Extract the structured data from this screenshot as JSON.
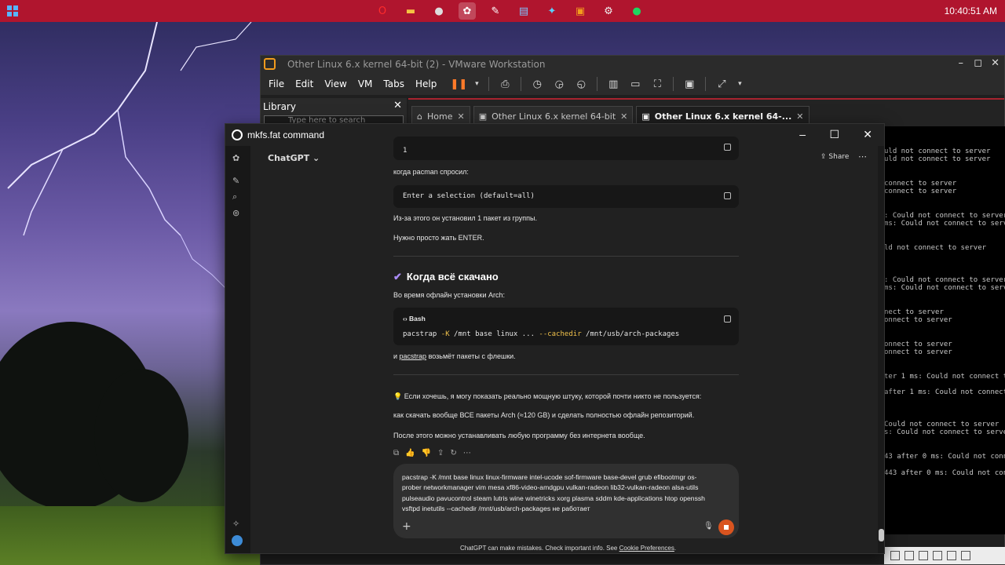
{
  "taskbar": {
    "clock": "10:40:51 AM",
    "icons": [
      "opera-icon",
      "file-explorer-icon",
      "obs-icon",
      "chatgpt-icon",
      "tool-icon",
      "notes-icon",
      "paint-icon",
      "vmware-icon",
      "settings-icon",
      "spotify-icon"
    ]
  },
  "vmware": {
    "title": "Other Linux 6.x kernel 64-bit (2) - VMware Workstation",
    "menu": [
      "File",
      "Edit",
      "View",
      "VM",
      "Tabs",
      "Help"
    ],
    "library": {
      "title": "Library",
      "search_placeholder": "Type here to search"
    },
    "tabs": [
      "Home",
      "Other Linux 6.x kernel 64-bit",
      "Other Linux 6.x kernel 64-..."
    ],
    "console_lines": [
      "uld not connect to server",
      "uld not connect to server",
      "connect to server",
      "connect to server",
      ": Could not connect to server",
      "ms: Could not connect to server",
      "ld not connect to server",
      ": Could not connect to server",
      "ms: Could not connect to server",
      "nect to server",
      "onnect to server",
      "onnect to server",
      "onnect to server",
      "ter 1 ms: Could not connect to s",
      "after 1 ms: Could not connect t",
      "Could not connect to server",
      "s: Could not connect to server",
      "43 after 0 ms: Could not connect",
      "443 after 0 ms: Could not conne"
    ]
  },
  "chatgpt": {
    "window_title": "mkfs.fat command",
    "model": "ChatGPT",
    "share": "Share",
    "code_top": "1",
    "p_asked": "когда pacman спросил:",
    "code_selection": "Enter a selection (default=all)",
    "p_installed": "Из-за этого он установил 1 пакет из группы.",
    "p_enter": "Нужно просто жать ENTER.",
    "h_downloaded": "Когда всё скачано",
    "p_offline": "Во время офлайн установки Arch:",
    "bash_label": "Bash",
    "code_pacstrap_cmd": "pacstrap",
    "code_pacstrap_k": "-K",
    "code_pacstrap_mid": "/mnt base linux ...",
    "code_pacstrap_cache": "--cachedir",
    "code_pacstrap_path": "/mnt/usb/arch-packages",
    "p_pacstrap_prefix": "и",
    "p_pacstrap_word": "pacstrap",
    "p_pacstrap_suffix": "возьмёт пакеты с флешки.",
    "p_tip": "Если хочешь, я могу показать реально мощную штуку, которой почти никто не пользуется:",
    "p_download_all": "как скачать вообще ВСЕ пакеты Arch (≈120 GB) и сделать полностью офлайн репозиторий.",
    "p_after": "После этого можно устанавливать любую программу без интернета вообще.",
    "input_text": "pacstrap -K /mnt base linux linux-firmware intel-ucode sof-firmware base-devel grub efibootmgr os-\nprober networkmanager vim mesa xf86-video-amdgpu vulkan-radeon lib32-vulkan-radeon alsa-utils\npulseaudio pavucontrol steam lutris wine winetricks xorg plasma sddm kde-applications htop openssh\nvsftpd inetutils --cachedir /mnt/usb/arch-packages не работает",
    "disclaimer": "ChatGPT can make mistakes. Check important info. See",
    "disclaimer_link": "Cookie Preferences"
  },
  "colors": {
    "taskbar": "#b0152e",
    "stop_button": "#d9541f",
    "check_accent": "#a98bf5"
  }
}
